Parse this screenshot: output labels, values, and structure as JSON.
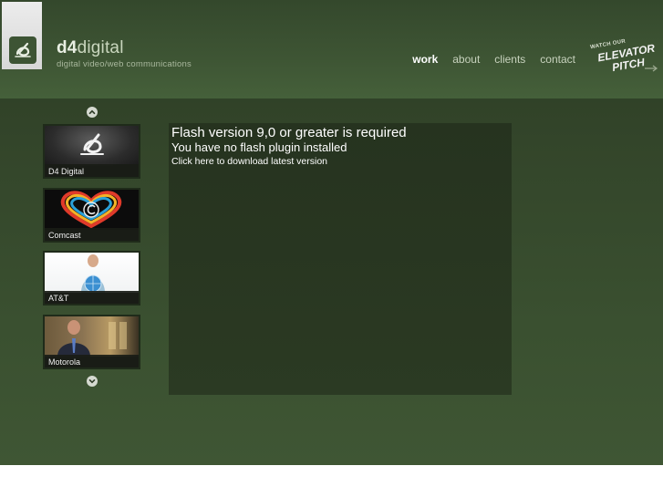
{
  "brand": {
    "name_bold": "d4",
    "name_light": "digital",
    "tagline": "digital video/web communications"
  },
  "nav": {
    "items": [
      {
        "label": "work",
        "active": true
      },
      {
        "label": "about",
        "active": false
      },
      {
        "label": "clients",
        "active": false
      },
      {
        "label": "contact",
        "active": false
      }
    ]
  },
  "promo": {
    "line_small": "WATCH OUR",
    "line_1": "ELEVATOR",
    "line_2": "PITCH"
  },
  "work_list": {
    "scroll_up_icon": "chevron-up-icon",
    "scroll_down_icon": "chevron-down-icon",
    "items": [
      {
        "label": "D4 Digital"
      },
      {
        "label": "Comcast"
      },
      {
        "label": "AT&T"
      },
      {
        "label": "Motorola"
      }
    ]
  },
  "flash_notice": {
    "title": "Flash version 9,0 or greater is required",
    "subtitle": "You have no flash plugin installed",
    "link": "Click here to download latest version"
  },
  "colors": {
    "header_green": "#3e5534",
    "body_green": "#33452a",
    "panel_green": "#2b3a23",
    "nav_text": "#c8d3be",
    "nav_active": "#ffffff"
  }
}
